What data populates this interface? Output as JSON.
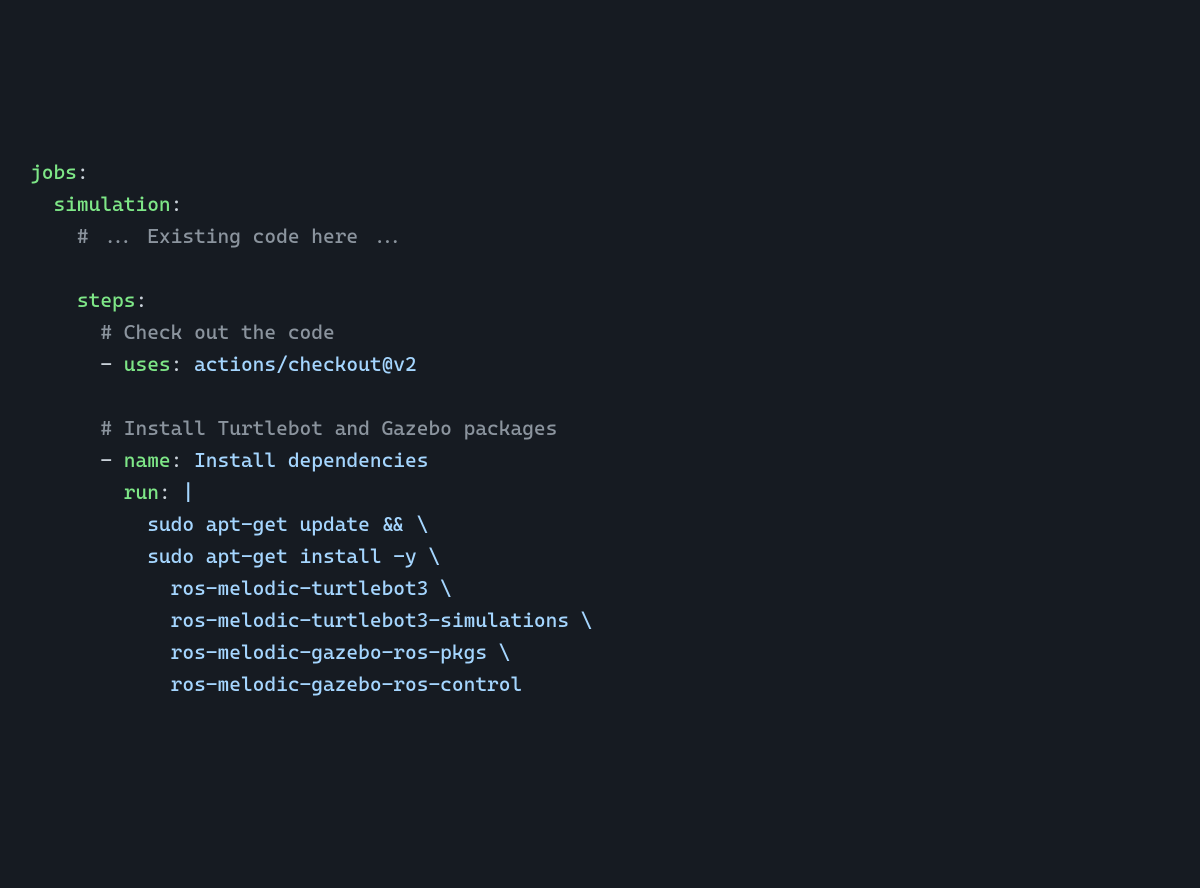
{
  "code": {
    "l1_key": "jobs",
    "l2_key": "simulation",
    "l3_comment": "# ... Existing code here ...",
    "l5_key": "steps",
    "l6_comment": "# Check out the code",
    "l7_dash": "-",
    "l7_key": "uses",
    "l7_value": "actions/checkout@v2",
    "l9_comment": "# Install Turtlebot and Gazebo packages",
    "l10_dash": "-",
    "l10_key": "name",
    "l10_value": "Install dependencies",
    "l11_key": "run",
    "l11_pipe": "|",
    "l12_value": "sudo apt-get update && \\",
    "l13_value": "sudo apt-get install -y \\",
    "l14_value": "ros-melodic-turtlebot3 \\",
    "l15_value": "ros-melodic-turtlebot3-simulations \\",
    "l16_value": "ros-melodic-gazebo-ros-pkgs \\",
    "l17_value": "ros-melodic-gazebo-ros-control"
  }
}
